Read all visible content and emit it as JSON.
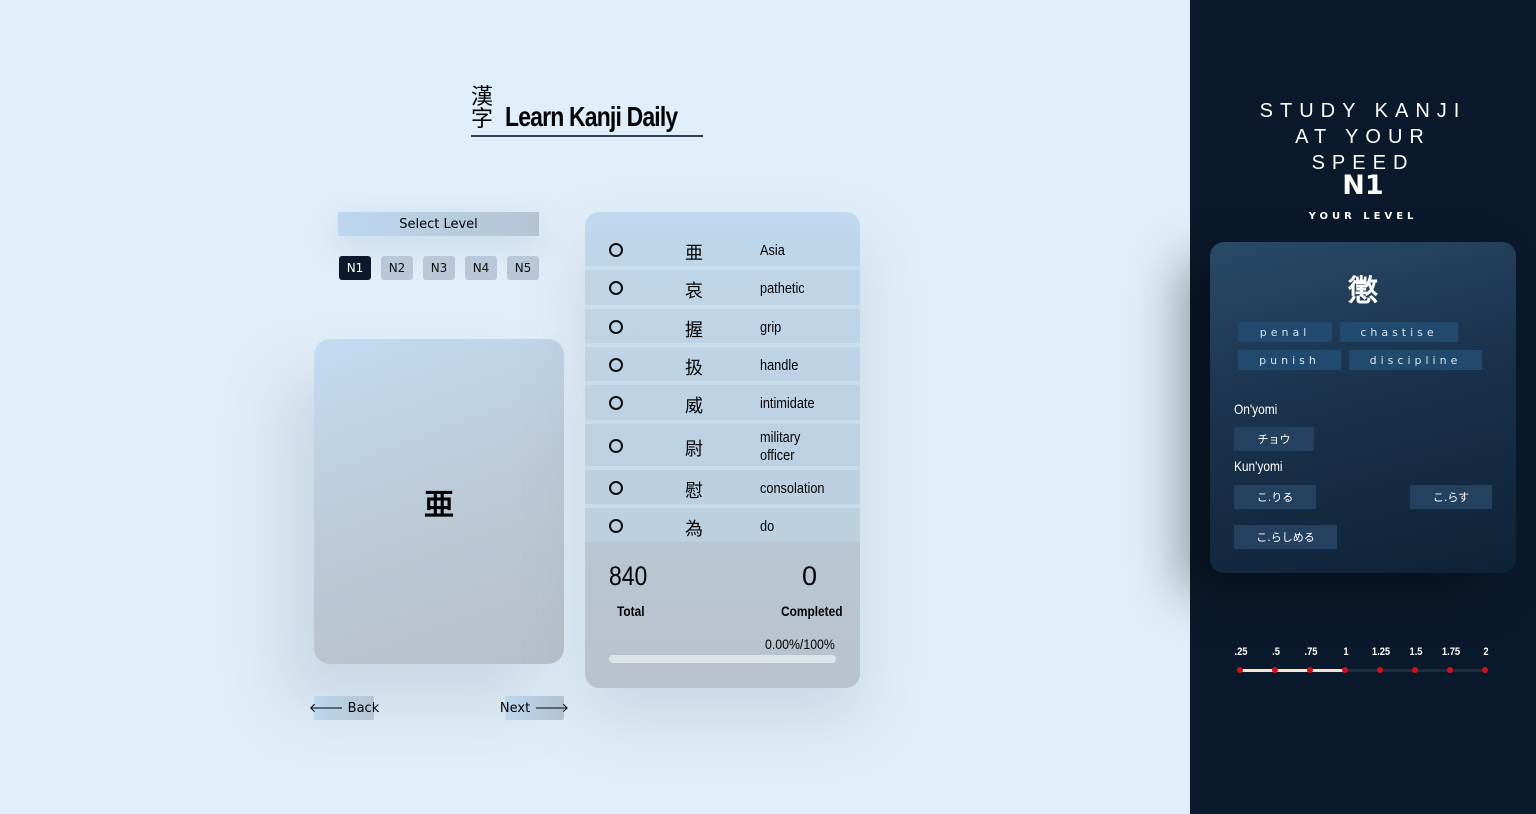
{
  "header": {
    "kanji_word": "漢字",
    "title": "Learn Kanji Daily"
  },
  "level_select": {
    "label": "Select Level",
    "levels": [
      "N1",
      "N2",
      "N3",
      "N4",
      "N5"
    ],
    "selected": "N1"
  },
  "flashcard": {
    "kanji": "亜"
  },
  "nav": {
    "back_label": "Back",
    "next_label": "Next"
  },
  "kanji_list": [
    {
      "kanji": "亜",
      "meaning": "Asia"
    },
    {
      "kanji": "哀",
      "meaning": "pathetic"
    },
    {
      "kanji": "握",
      "meaning": "grip"
    },
    {
      "kanji": "扱",
      "meaning": "handle"
    },
    {
      "kanji": "威",
      "meaning": "intimidate"
    },
    {
      "kanji": "尉",
      "meaning": "military officer"
    },
    {
      "kanji": "慰",
      "meaning": "consolation"
    },
    {
      "kanji": "為",
      "meaning": "do"
    }
  ],
  "stats": {
    "total": "840",
    "total_label": "Total",
    "completed": "0",
    "completed_label": "Completed",
    "percent_text": "0.00%/100%",
    "progress": 0
  },
  "sidebar": {
    "tagline": "STUDY KANJI AT YOUR SPEED",
    "level_value": "N1",
    "level_label": "YOUR LEVEL",
    "detail": {
      "kanji": "懲",
      "meanings": [
        "penal",
        "chastise",
        "punish",
        "discipline"
      ],
      "onyomi_label": "On'yomi",
      "onyomi": [
        "チョウ"
      ],
      "kunyomi_label": "Kun'yomi",
      "kunyomi": [
        "こ.りる",
        "こ.らす",
        "こ.らしめる"
      ]
    },
    "speed": {
      "options": [
        ".25",
        ".5",
        ".75",
        "1",
        "1.25",
        "1.5",
        "1.75",
        "2"
      ],
      "selected": "1"
    }
  },
  "colors": {
    "background": "#e0eef9",
    "sidebar": "#0a1a2c",
    "accent_dark": "#0c1a2e",
    "chip": "#214a6e",
    "speed_dot": "#d40f1b"
  }
}
